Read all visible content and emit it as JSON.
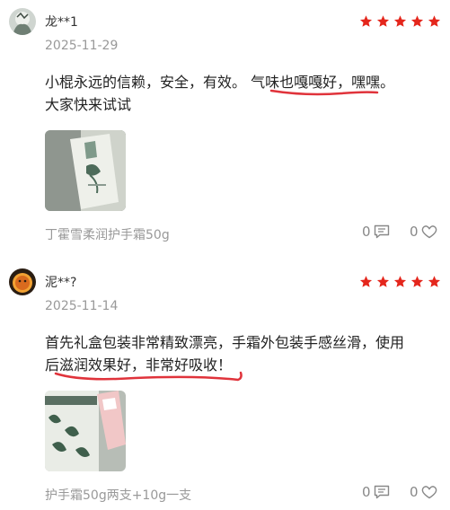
{
  "reviews": [
    {
      "username": "龙**1",
      "rating": 5,
      "date": "2025-11-29",
      "text_lines": [
        "小棍永远的信赖，安全，有效。 气味也嘎嘎好，嘿嘿。",
        "大家快来试试"
      ],
      "product": "丁霍雪柔润护手霜50g",
      "comment_count": "0",
      "like_count": "0"
    },
    {
      "username": "泥**?",
      "rating": 5,
      "date": "2025-11-14",
      "text_lines": [
        "首先礼盒包装非常精致漂亮，手霜外包装手感丝滑，使用",
        "后滋润效果好，非常好吸收！"
      ],
      "product": "护手霜50g两支+10g一支",
      "comment_count": "0",
      "like_count": "0"
    }
  ],
  "colors": {
    "star": "#e4261c",
    "underline": "#e0333b",
    "muted": "#999999"
  },
  "icons": {
    "comment": "comment-icon",
    "like": "heart-icon",
    "star": "star-icon"
  }
}
